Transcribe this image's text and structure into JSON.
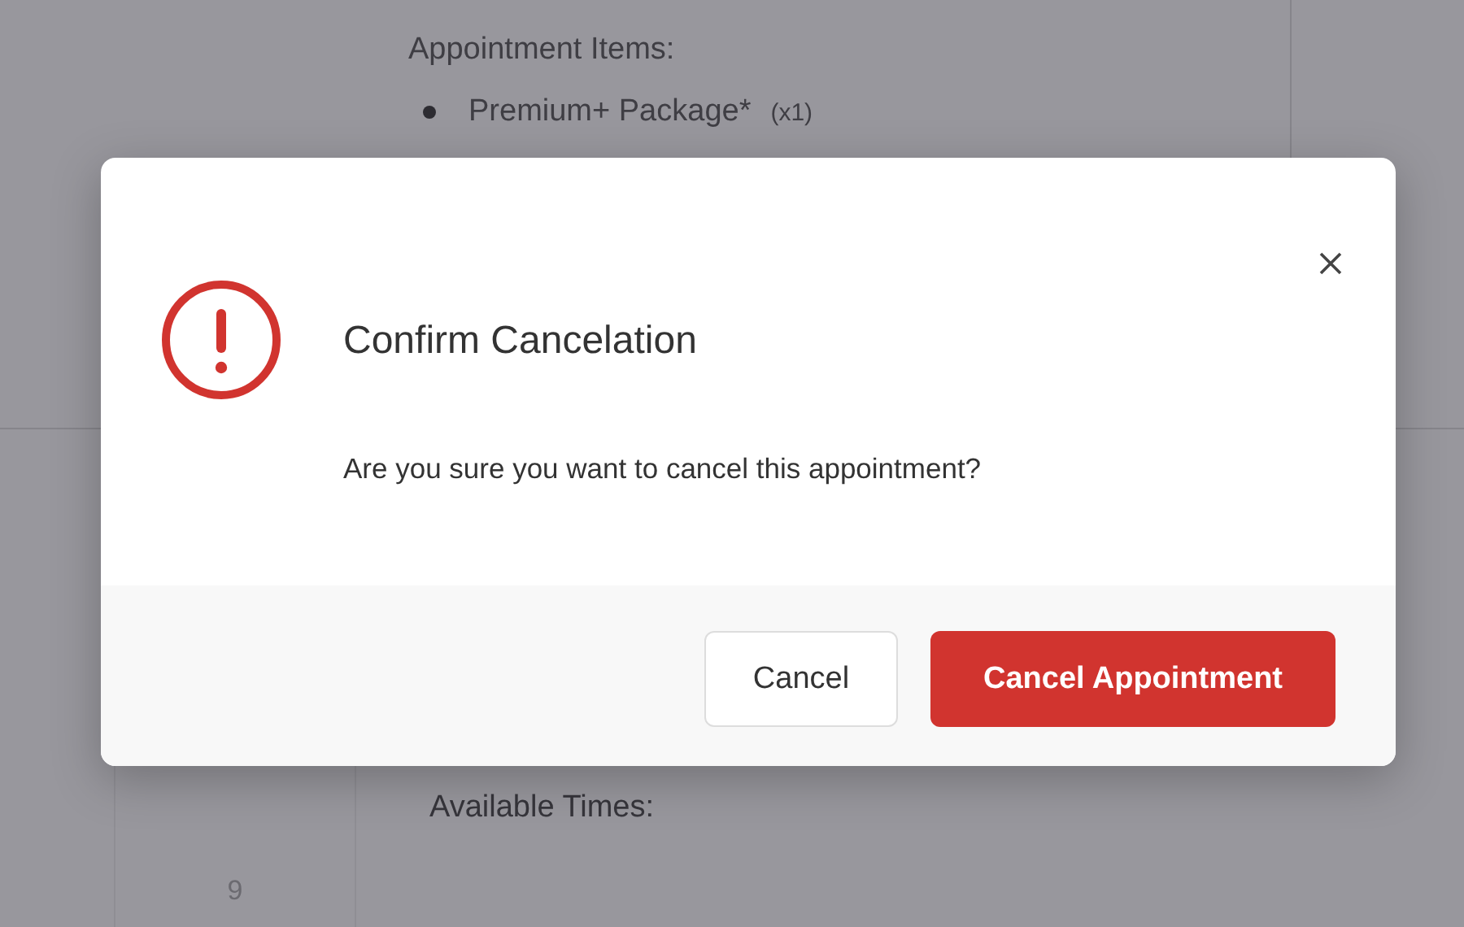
{
  "background": {
    "items_heading": "Appointment Items:",
    "items": [
      {
        "name": "Premium+ Package*",
        "quantity": "(x1)"
      }
    ],
    "times_heading": "Available Times:",
    "row_number": "9"
  },
  "dialog": {
    "title": "Confirm Cancelation",
    "message": "Are you sure you want to cancel this appointment?",
    "buttons": [
      {
        "label": "Cancel",
        "kind": "secondary"
      },
      {
        "label": "Cancel Appointment",
        "kind": "danger"
      }
    ]
  }
}
